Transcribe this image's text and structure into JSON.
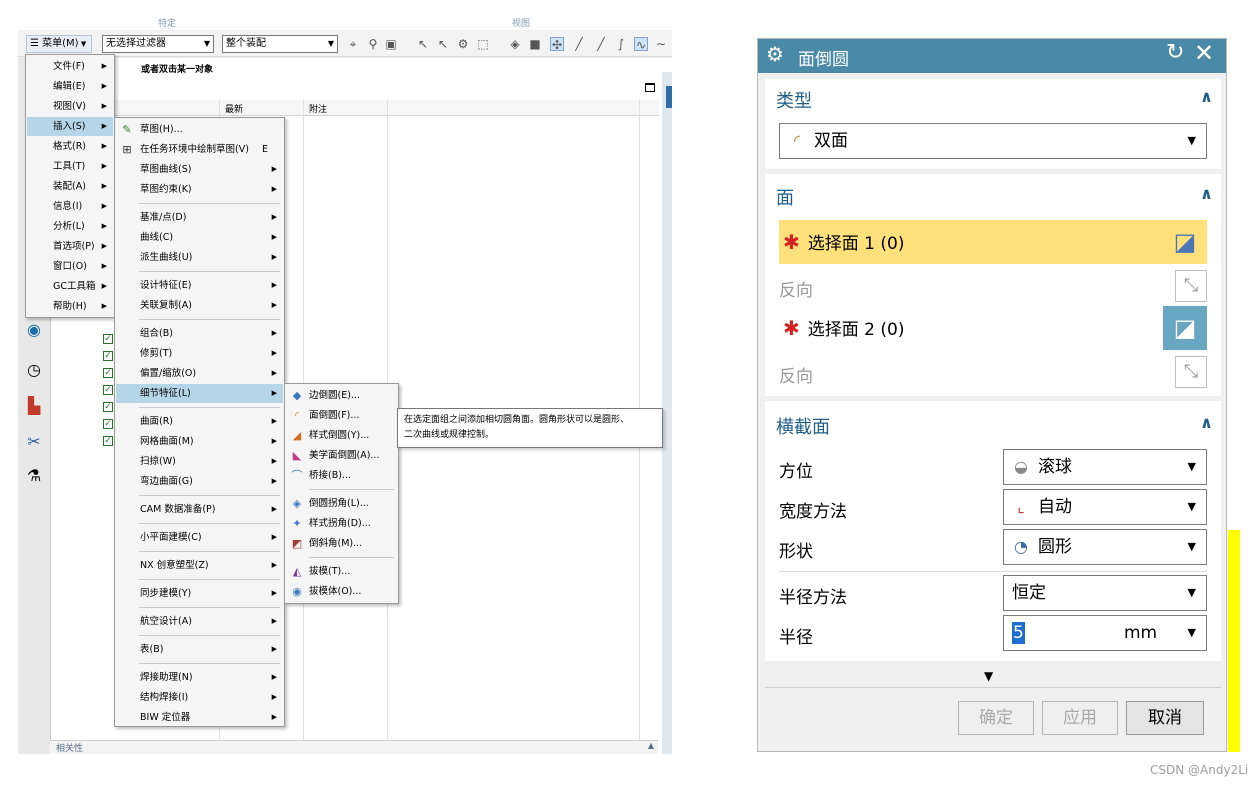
{
  "nx": {
    "toolbar": {
      "menu_label": "菜单(M)",
      "filter_value": "无选择过滤器",
      "assembly_value": "整个装配",
      "top_strip": [
        "特定",
        "视图"
      ]
    },
    "nav": {
      "hint": "或者双击某一对象",
      "col_latest": "最新",
      "col_note": "附注",
      "footer_label": "相关性"
    },
    "main_menu": [
      {
        "label": "文件(F)"
      },
      {
        "label": "编辑(E)"
      },
      {
        "label": "视图(V)"
      },
      {
        "label": "插入(S)"
      },
      {
        "label": "格式(R)"
      },
      {
        "label": "工具(T)"
      },
      {
        "label": "装配(A)"
      },
      {
        "label": "信息(I)"
      },
      {
        "label": "分析(L)"
      },
      {
        "label": "首选项(P)"
      },
      {
        "label": "窗口(O)"
      },
      {
        "label": "GC工具箱"
      },
      {
        "label": "帮助(H)"
      }
    ],
    "insert_menu": [
      {
        "label": "草图(H)..."
      },
      {
        "label": "在任务环境中绘制草图(V)",
        "shortcut": "E"
      },
      {
        "label": "草图曲线(S)"
      },
      {
        "label": "草图约束(K)"
      },
      {
        "label": "基准/点(D)"
      },
      {
        "label": "曲线(C)"
      },
      {
        "label": "派生曲线(U)"
      },
      {
        "label": "设计特征(E)"
      },
      {
        "label": "关联复制(A)"
      },
      {
        "label": "组合(B)"
      },
      {
        "label": "修剪(T)"
      },
      {
        "label": "偏置/缩放(O)"
      },
      {
        "label": "细节特征(L)"
      },
      {
        "label": "曲面(R)"
      },
      {
        "label": "网格曲面(M)"
      },
      {
        "label": "扫掠(W)"
      },
      {
        "label": "弯边曲面(G)"
      },
      {
        "label": "CAM 数据准备(P)"
      },
      {
        "label": "小平面建模(C)"
      },
      {
        "label": "NX 创意塑型(Z)"
      },
      {
        "label": "同步建模(Y)"
      },
      {
        "label": "航空设计(A)"
      },
      {
        "label": "表(B)"
      },
      {
        "label": "焊接助理(N)"
      },
      {
        "label": "结构焊接(I)"
      },
      {
        "label": "BIW 定位器"
      }
    ],
    "detail_menu": [
      {
        "label": "边倒圆(E)..."
      },
      {
        "label": "面倒圆(F)..."
      },
      {
        "label": "样式倒圆(Y)..."
      },
      {
        "label": "美学面倒圆(A)..."
      },
      {
        "label": "桥接(B)..."
      },
      {
        "label": "倒圆拐角(L)..."
      },
      {
        "label": "样式拐角(D)..."
      },
      {
        "label": "倒斜角(M)..."
      },
      {
        "label": "拔模(T)..."
      },
      {
        "label": "拔模体(O)..."
      }
    ],
    "tooltip": [
      "在选定面组之间添加相切圆角面。圆角形状可以是圆形、",
      "二次曲线或规律控制。"
    ]
  },
  "dialog": {
    "title": "面倒圆",
    "type_group": {
      "header": "类型",
      "value": "双面"
    },
    "face_group": {
      "header": "面",
      "select1": "选择面 1 (0)",
      "reverse1": "反向",
      "select2": "选择面 2 (0)",
      "reverse2": "反向"
    },
    "section_group": {
      "header": "横截面",
      "orientation_label": "方位",
      "orientation_value": "滚球",
      "width_method_label": "宽度方法",
      "width_method_value": "自动",
      "shape_label": "形状",
      "shape_value": "圆形",
      "radius_method_label": "半径方法",
      "radius_method_value": "恒定",
      "radius_label": "半径",
      "radius_value": "5",
      "radius_unit": "mm"
    },
    "buttons": {
      "ok": "确定",
      "apply": "应用",
      "cancel": "取消"
    }
  },
  "watermark": "CSDN @Andy2Li",
  "colors": {
    "title_bar": "#4a8aa6",
    "highlight_row": "#ffe07a",
    "menu_active": "#b5d6e6",
    "required_star": "#d42020"
  }
}
